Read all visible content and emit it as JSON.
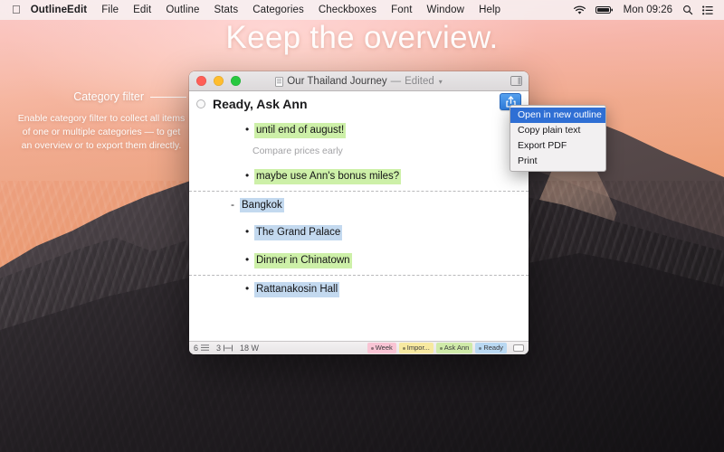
{
  "menubar": {
    "apple_icon": "apple-logo-icon",
    "app_name": "OutlineEdit",
    "items": [
      "File",
      "Edit",
      "Outline",
      "Stats",
      "Categories",
      "Checkboxes",
      "Font",
      "Window",
      "Help"
    ],
    "status": {
      "wifi_icon": "wifi-icon",
      "battery_icon": "battery-icon",
      "clock": "Mon 09:26",
      "search_icon": "search-icon",
      "notification_center_icon": "list-icon"
    }
  },
  "hero": {
    "headline": "Keep the overview."
  },
  "annotation": {
    "title": "Category filter",
    "body": "Enable category filter to collect all items of one or multiple categories — to get an overview or to export them directly."
  },
  "window": {
    "titlebar": {
      "doc_icon": "document-icon",
      "title": "Our Thailand Journey",
      "dash": "—",
      "edited": "Edited",
      "chevron_icon": "chevron-down-icon",
      "right_icon": "sidebar-toggle-icon"
    },
    "toolbar": {
      "checkbox_icon": "circle-checkbox-icon",
      "heading": "Ready, Ask Ann",
      "share_icon": "share-icon"
    },
    "outline": {
      "rows": [
        {
          "kind": "item",
          "level": 1,
          "marker": "•",
          "text": "until end of august!",
          "highlight": "green"
        },
        {
          "kind": "note",
          "level": 1,
          "marker": "",
          "text": "Compare prices early",
          "highlight": "none"
        },
        {
          "kind": "item",
          "level": 1,
          "marker": "•",
          "text": "maybe use Ann's bonus miles?",
          "highlight": "green"
        },
        {
          "kind": "separator"
        },
        {
          "kind": "item",
          "level": 0,
          "marker": "-",
          "text": "Bangkok",
          "highlight": "blue"
        },
        {
          "kind": "item",
          "level": 1,
          "marker": "•",
          "text": "The Grand Palace",
          "highlight": "blue"
        },
        {
          "kind": "item",
          "level": 1,
          "marker": "•",
          "text": "Dinner in Chinatown",
          "highlight": "green"
        },
        {
          "kind": "separator"
        },
        {
          "kind": "item",
          "level": 1,
          "marker": "•",
          "text": "Rattanakosin Hall",
          "highlight": "blue"
        }
      ]
    },
    "statusbar": {
      "items_count": "6",
      "items_icon": "list-lines-icon",
      "level_count": "3",
      "level_icon": "indent-icon",
      "word_count": "18 W",
      "badges": [
        {
          "label": "Week",
          "color": "#f9c4d4"
        },
        {
          "label": "Impor...",
          "color": "#f7e9a0"
        },
        {
          "label": "Ask Ann",
          "color": "#cfeaa8"
        },
        {
          "label": "Ready",
          "color": "#b9d8f2"
        }
      ],
      "end_icon": "categories-toggle-icon"
    }
  },
  "dropdown": {
    "items": [
      {
        "label": "Open in new outline",
        "selected": true
      },
      {
        "label": "Copy plain text",
        "selected": false
      },
      {
        "label": "Export PDF",
        "selected": false
      },
      {
        "label": "Print",
        "selected": false
      }
    ]
  }
}
